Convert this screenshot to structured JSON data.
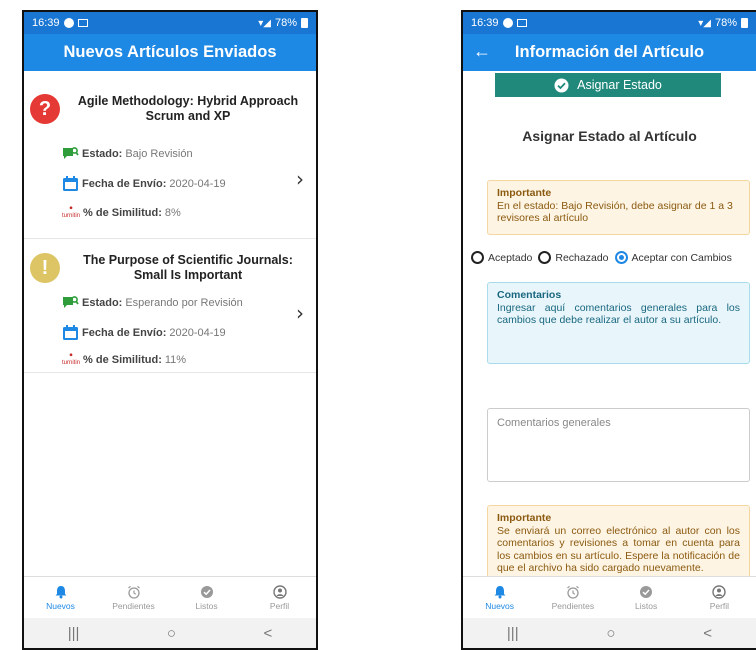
{
  "status_bar": {
    "time": "16:39",
    "battery": "78%"
  },
  "screen1": {
    "title": "Nuevos Artículos Enviados",
    "articles": [
      {
        "icon": "question-icon",
        "icon_symbol": "?",
        "icon_color": "#e53935",
        "title": "Agile Methodology: Hybrid Approach Scrum and XP",
        "estado_label": "Estado:",
        "estado_value": "Bajo Revisión",
        "fecha_label": "Fecha de Envío:",
        "fecha_value": "2020-04-19",
        "similitud_label": "% de Similitud:",
        "similitud_value": "8%",
        "turnitin_text": "turnitin"
      },
      {
        "icon": "exclamation-icon",
        "icon_symbol": "!",
        "icon_color": "#ddc565",
        "title": "The Purpose of Scientific Journals: Small Is Important",
        "estado_label": "Estado:",
        "estado_value": "Esperando por Revisión",
        "fecha_label": "Fecha de Envío:",
        "fecha_value": "2020-04-19",
        "similitud_label": "% de Similitud:",
        "similitud_value": "11%",
        "turnitin_text": "turnitin"
      }
    ]
  },
  "screen2": {
    "title": "Información del Artículo",
    "assign_button": "Asignar Estado",
    "section_title": "Asignar Estado al Artículo",
    "note1": {
      "heading": "Importante",
      "text": "En el estado: Bajo Revisión, debe asignar de 1 a 3 revisores al artículo"
    },
    "radio_options": [
      "Aceptado",
      "Rechazado",
      "Aceptar con Cambios"
    ],
    "selected_option": "Aceptar con Cambios",
    "comments_note": {
      "heading": "Comentarios",
      "text": "Ingresar aquí comentarios generales para los cambios que debe realizar el autor a su artículo."
    },
    "comments_placeholder": "Comentarios generales",
    "note2": {
      "heading": "Importante",
      "text": "Se enviará un correo electrónico al autor con los comentarios y revisiones a tomar en cuenta para los cambios en su artículo. Espere la notificación de que el archivo ha sido cargado nuevamente."
    }
  },
  "bottom_nav": [
    {
      "label": "Nuevos",
      "icon": "bell-icon",
      "active": true
    },
    {
      "label": "Pendientes",
      "icon": "alarm-clock-icon",
      "active": false
    },
    {
      "label": "Listos",
      "icon": "check-circle-icon",
      "active": false
    },
    {
      "label": "Perfil",
      "icon": "user-circle-icon",
      "active": false
    }
  ],
  "system_nav": {
    "recents": "|||",
    "home": "○",
    "back": "<"
  }
}
